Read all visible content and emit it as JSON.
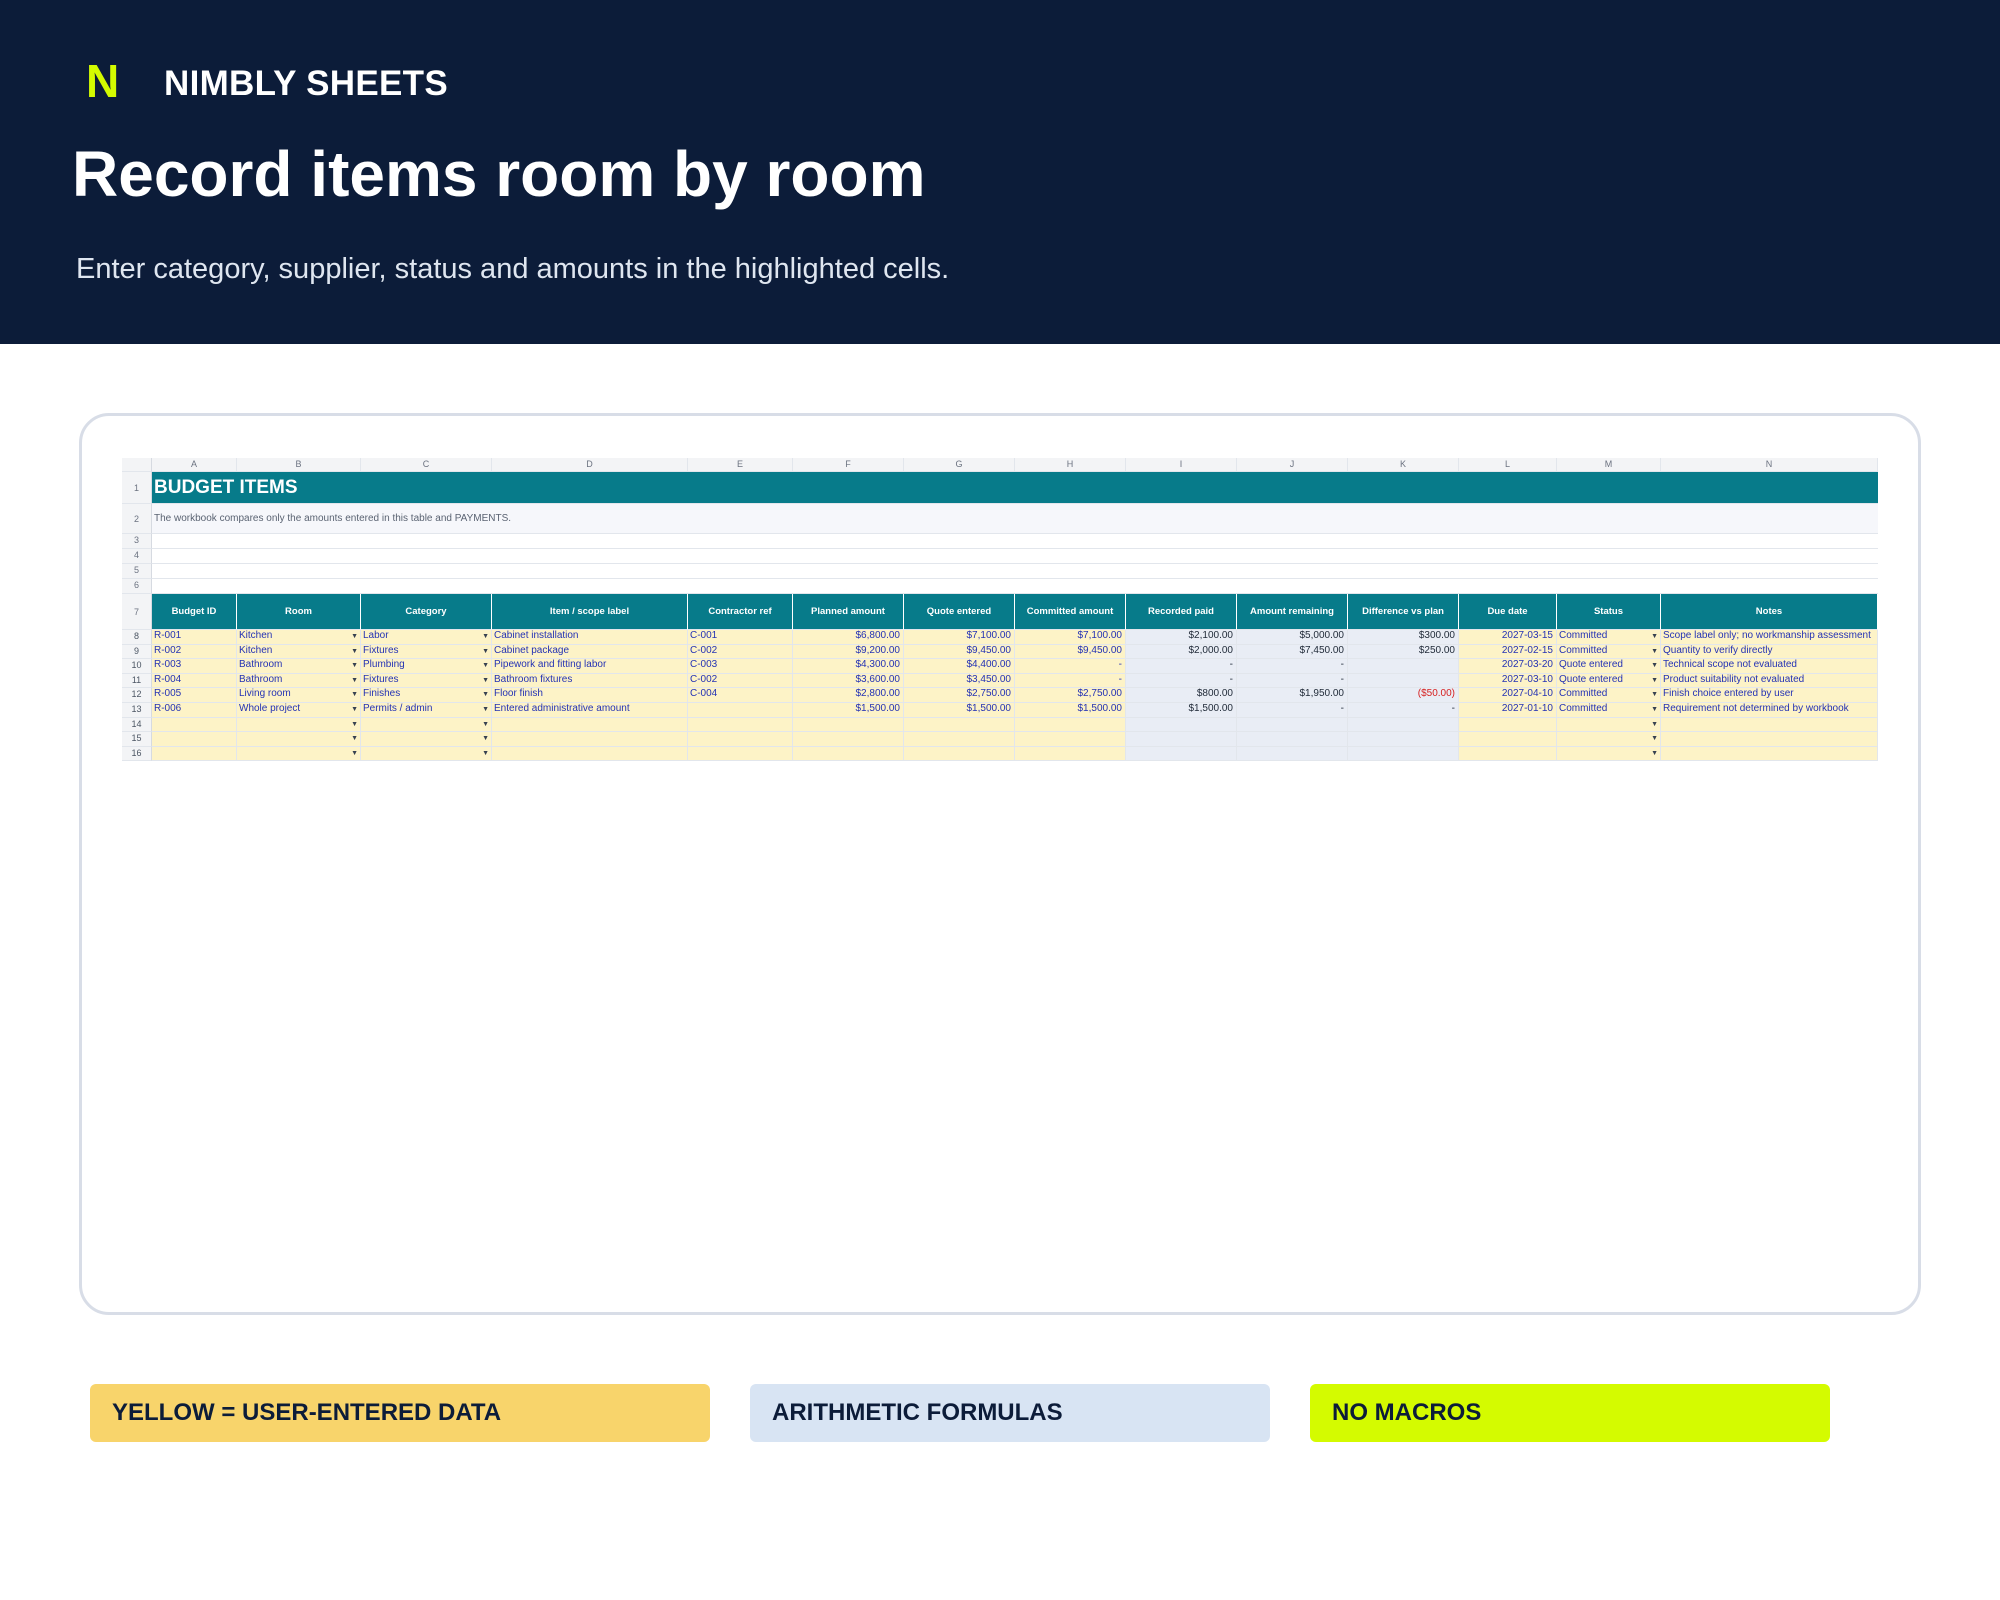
{
  "brand": {
    "mark": "N",
    "name": "NIMBLY SHEETS"
  },
  "hero": {
    "title": "Record items room by room",
    "subtitle": "Enter category, supplier, status and amounts in the highlighted cells."
  },
  "sheet": {
    "columns": [
      "A",
      "B",
      "C",
      "D",
      "E",
      "F",
      "G",
      "H",
      "I",
      "J",
      "K",
      "L",
      "M",
      "N"
    ],
    "row_numbers": {
      "r1": "1",
      "r2": "2",
      "r3": "3",
      "r4": "4",
      "r5": "5",
      "r6": "6",
      "r7": "7"
    },
    "title": "BUDGET ITEMS",
    "note": "The workbook compares only the amounts entered in this table and PAYMENTS.",
    "headers": [
      "Budget ID",
      "Room",
      "Category",
      "Item / scope label",
      "Contractor ref",
      "Planned amount",
      "Quote entered",
      "Committed amount",
      "Recorded paid",
      "Amount remaining",
      "Difference vs plan",
      "Due date",
      "Status",
      "Notes"
    ],
    "rows": [
      {
        "num": "8",
        "id": "R-001",
        "room": "Kitchen",
        "category": "Labor",
        "item": "Cabinet installation",
        "contractor": "C-001",
        "planned": "$6,800.00",
        "quote": "$7,100.00",
        "committed": "$7,100.00",
        "paid": "$2,100.00",
        "remaining": "$5,000.00",
        "diff": "$300.00",
        "due": "2027-03-15",
        "status": "Committed",
        "notes": "Scope label only; no workmanship assessment"
      },
      {
        "num": "9",
        "id": "R-002",
        "room": "Kitchen",
        "category": "Fixtures",
        "item": "Cabinet package",
        "contractor": "C-002",
        "planned": "$9,200.00",
        "quote": "$9,450.00",
        "committed": "$9,450.00",
        "paid": "$2,000.00",
        "remaining": "$7,450.00",
        "diff": "$250.00",
        "due": "2027-02-15",
        "status": "Committed",
        "notes": "Quantity to verify directly"
      },
      {
        "num": "10",
        "id": "R-003",
        "room": "Bathroom",
        "category": "Plumbing",
        "item": "Pipework and fitting labor",
        "contractor": "C-003",
        "planned": "$4,300.00",
        "quote": "$4,400.00",
        "committed": "-",
        "paid": "-",
        "remaining": "-",
        "diff": "",
        "due": "2027-03-20",
        "status": "Quote entered",
        "notes": "Technical scope not evaluated"
      },
      {
        "num": "11",
        "id": "R-004",
        "room": "Bathroom",
        "category": "Fixtures",
        "item": "Bathroom fixtures",
        "contractor": "C-002",
        "planned": "$3,600.00",
        "quote": "$3,450.00",
        "committed": "-",
        "paid": "-",
        "remaining": "-",
        "diff": "",
        "due": "2027-03-10",
        "status": "Quote entered",
        "notes": "Product suitability not evaluated"
      },
      {
        "num": "12",
        "id": "R-005",
        "room": "Living room",
        "category": "Finishes",
        "item": "Floor finish",
        "contractor": "C-004",
        "planned": "$2,800.00",
        "quote": "$2,750.00",
        "committed": "$2,750.00",
        "paid": "$800.00",
        "remaining": "$1,950.00",
        "diff": "($50.00)",
        "due": "2027-04-10",
        "status": "Committed",
        "notes": "Finish choice entered by user"
      },
      {
        "num": "13",
        "id": "R-006",
        "room": "Whole project",
        "category": "Permits / admin",
        "item": "Entered administrative amount",
        "contractor": "",
        "planned": "$1,500.00",
        "quote": "$1,500.00",
        "committed": "$1,500.00",
        "paid": "$1,500.00",
        "remaining": "-",
        "diff": "-",
        "due": "2027-01-10",
        "status": "Committed",
        "notes": "Requirement not determined by workbook"
      },
      {
        "num": "14",
        "id": "",
        "room": "",
        "category": "",
        "item": "",
        "contractor": "",
        "planned": "",
        "quote": "",
        "committed": "",
        "paid": "",
        "remaining": "",
        "diff": "",
        "due": "",
        "status": "",
        "notes": ""
      },
      {
        "num": "15",
        "id": "",
        "room": "",
        "category": "",
        "item": "",
        "contractor": "",
        "planned": "",
        "quote": "",
        "committed": "",
        "paid": "",
        "remaining": "",
        "diff": "",
        "due": "",
        "status": "",
        "notes": ""
      },
      {
        "num": "16",
        "id": "",
        "room": "",
        "category": "",
        "item": "",
        "contractor": "",
        "planned": "",
        "quote": "",
        "committed": "",
        "paid": "",
        "remaining": "",
        "diff": "",
        "due": "",
        "status": "",
        "notes": ""
      }
    ]
  },
  "legend": {
    "yellow": "YELLOW = USER-ENTERED DATA",
    "blue": "ARITHMETIC FORMULAS",
    "lime": "NO MACROS"
  },
  "colors": {
    "header_bg": "#0c1c39",
    "brand_accent": "#d4fb00",
    "table_header": "#077b8a",
    "input_fill": "#fdf3c7",
    "formula_fill": "#e9edf5",
    "negative": "#d61f1f"
  },
  "icons": {
    "dropdown": "dropdown-arrow-icon"
  }
}
